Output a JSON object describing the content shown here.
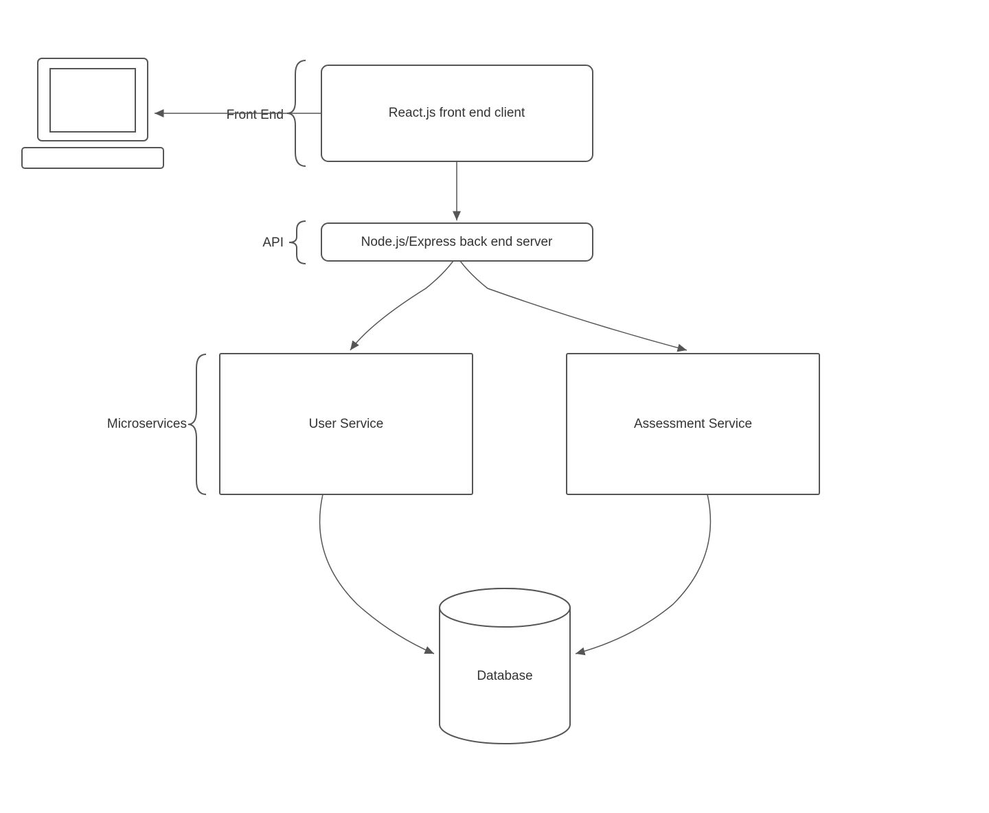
{
  "labels": {
    "front_end": "Front End",
    "api": "API",
    "microservices": "Microservices"
  },
  "nodes": {
    "react_client": "React.js front end client",
    "node_server": "Node.js/Express back end server",
    "user_service": "User Service",
    "assessment_service": "Assessment Service",
    "database": "Database"
  }
}
